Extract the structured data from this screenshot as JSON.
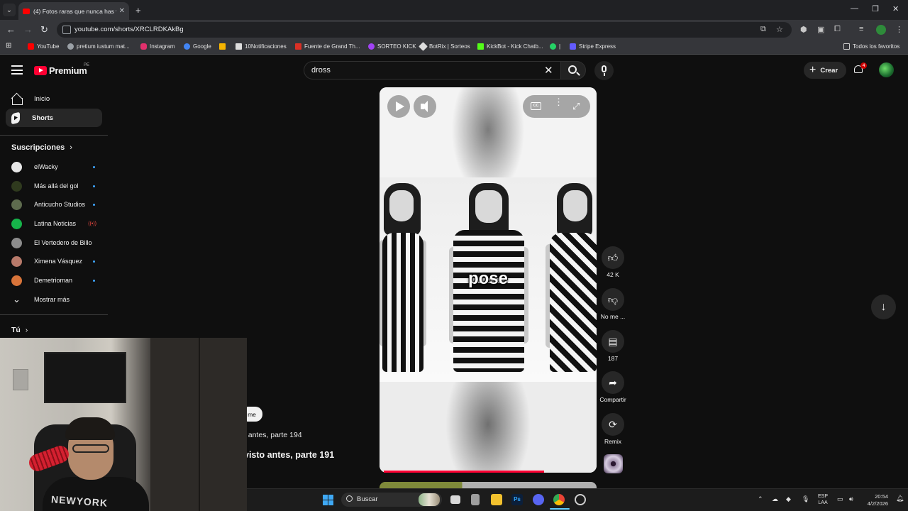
{
  "browser": {
    "tab_title": "(4) Fotos raras que nunca has visto",
    "url": "youtube.com/shorts/XRCLRDKAkBg",
    "bookmarks": [
      {
        "label": "YouTube",
        "color": "#ff0000"
      },
      {
        "label": "pretium iustum mat...",
        "color": "#9aa0a6"
      },
      {
        "label": "Instagram",
        "color": "#e1306c"
      },
      {
        "label": "Google",
        "color": "#4285f4"
      },
      {
        "label": "10Notificaciones",
        "color": "#dddddd"
      },
      {
        "label": "Fuente de Grand Th...",
        "color": "#d93025"
      },
      {
        "label": "SORTEO KICK",
        "color": "#a142f4"
      },
      {
        "label": "BotRix | Sorteos",
        "color": "#dddddd"
      },
      {
        "label": "KickBot - Kick Chatb...",
        "color": "#53fc18"
      },
      {
        "label": "|",
        "color": "#25d366"
      },
      {
        "label": "Stripe Express",
        "color": "#635bff"
      }
    ],
    "all_bookmarks": "Todos los favoritos"
  },
  "header": {
    "logo_text": "Premium",
    "country": "PE",
    "search_value": "dross",
    "create_label": "Crear",
    "notification_count": "4"
  },
  "sidebar": {
    "home_label": "Inicio",
    "shorts_label": "Shorts",
    "subscriptions_title": "Suscripciones",
    "subscriptions": [
      {
        "name": "elWacky",
        "indicator": "dot",
        "color": "#e8e8e8"
      },
      {
        "name": "Más allá del gol",
        "indicator": "dot",
        "color": "#2f3a1e"
      },
      {
        "name": "Anticucho Studios",
        "indicator": "dot",
        "color": "#5e6b4e"
      },
      {
        "name": "Latina Noticias",
        "indicator": "live",
        "color": "#16b34a"
      },
      {
        "name": "El Vertedero de Billo",
        "indicator": "none",
        "color": "#8c8c8c"
      },
      {
        "name": "Ximena Vásquez",
        "indicator": "dot",
        "color": "#b87a6a"
      },
      {
        "name": "Demetrioman",
        "indicator": "dot",
        "color": "#d8743a"
      }
    ],
    "show_more": "Mostrar más",
    "you_title": "Tú"
  },
  "behind_overlay": {
    "chip": "me",
    "line1": "o antes, parte 194",
    "line2": "visto antes, parte 191"
  },
  "player": {
    "caption": "pose",
    "progress": 0.77
  },
  "actions": {
    "likes": "42 K",
    "dislike_label": "No me ...",
    "comments": "187",
    "share_label": "Compartir",
    "remix_label": "Remix"
  },
  "webcam": {
    "shirt_text": "NEWYORK"
  },
  "taskbar": {
    "search_label": "Buscar",
    "lang_1": "ESP",
    "lang_2": "LAA",
    "time": "20:54",
    "date": "4/2/2026"
  }
}
